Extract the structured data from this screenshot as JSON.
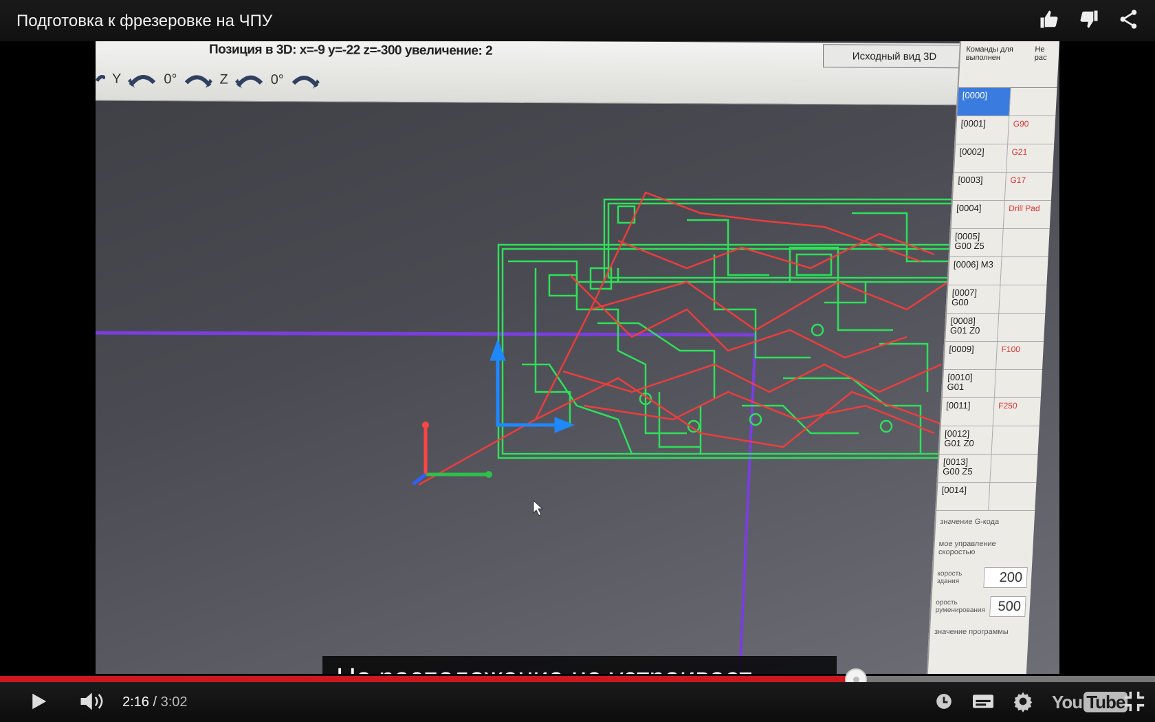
{
  "video": {
    "title": "Подготовка к фрезеровке на ЧПУ",
    "subtitle": "Но расположение не устраивает..."
  },
  "app": {
    "position_text": "Позиция в 3D: x=-9 y=-22 z=-300 увеличение: 2",
    "view3d_button": "Исходный вид 3D",
    "rotation": {
      "y_label": "Y",
      "y_value": "0°",
      "z_label": "Z",
      "z_value": "0°"
    },
    "commands_header": {
      "col1": "Команды для выполнен",
      "col2": "Не рас"
    },
    "commands": [
      {
        "num": "[0000]",
        "code": ""
      },
      {
        "num": "[0001]",
        "code": "G90"
      },
      {
        "num": "[0002]",
        "code": "G21"
      },
      {
        "num": "[0003]",
        "code": "G17"
      },
      {
        "num": "[0004]",
        "code": "Drill Pad"
      },
      {
        "num": "[0005] G00 Z5",
        "code": ""
      },
      {
        "num": "[0006] M3",
        "code": ""
      },
      {
        "num": "[0007] G00",
        "code": ""
      },
      {
        "num": "[0008] G01 Z0",
        "code": ""
      },
      {
        "num": "[0009]",
        "code": "F100"
      },
      {
        "num": "[0010] G01",
        "code": ""
      },
      {
        "num": "[0011]",
        "code": "F250"
      },
      {
        "num": "[0012] G01 Z0",
        "code": ""
      },
      {
        "num": "[0013] G00 Z5",
        "code": ""
      },
      {
        "num": "[0014]",
        "code": ""
      }
    ],
    "panel": {
      "label_value": "значение G-кода",
      "label_speed_mgmt": "мое управление скоростью",
      "speed1_label": "корость здания",
      "speed1_value": "200",
      "speed2_label": "орость руменирования",
      "speed2_value": "500",
      "label_program": "значение программы"
    }
  },
  "player": {
    "current_time": "2:16",
    "separator": " / ",
    "duration": "3:02",
    "progress_fraction": 0.7413,
    "logo_you": "You",
    "logo_tube": "Tube",
    "colors": {
      "played": "#cc181e",
      "background": "#111111"
    }
  }
}
